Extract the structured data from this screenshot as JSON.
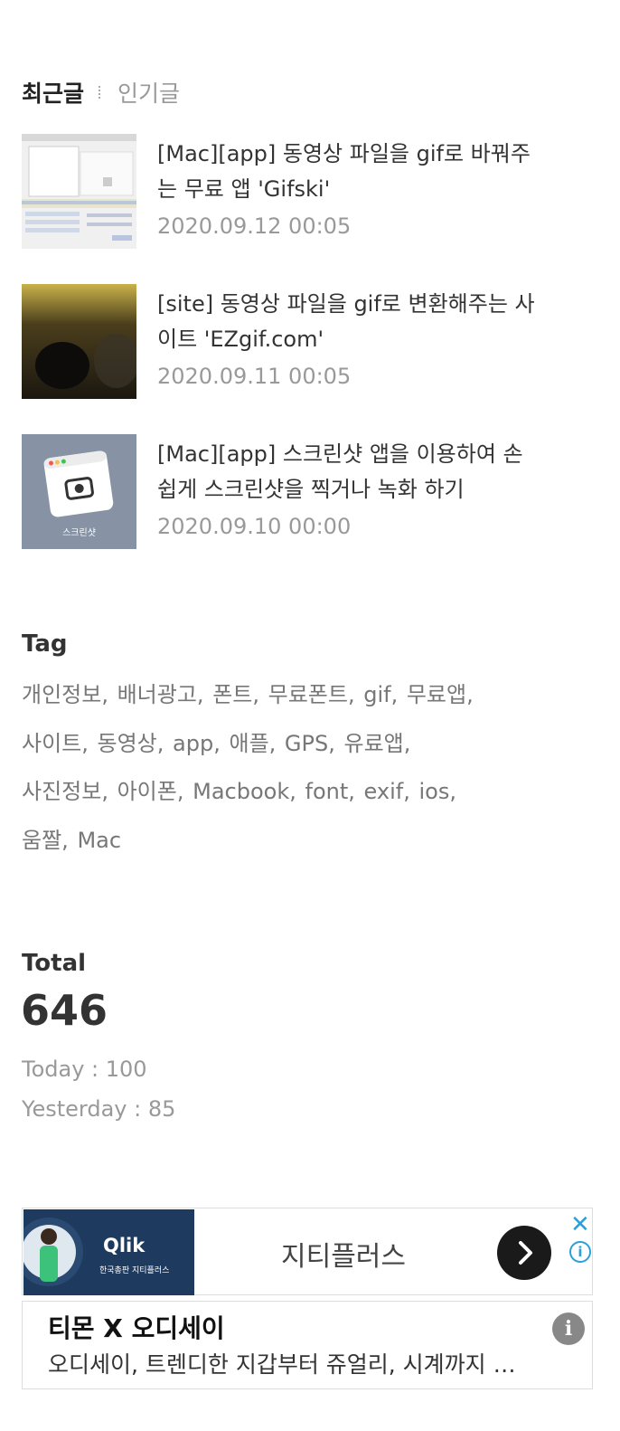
{
  "tabs": {
    "recent": "최근글",
    "popular": "인기글"
  },
  "posts": [
    {
      "title": "[Mac][app] 동영상 파일을 gif로 바꿔주는 무료 앱 'Gifski'",
      "date": "2020.09.12 00:05"
    },
    {
      "title": "[site] 동영상 파일을 gif로 변환해주는 사이트 'EZgif.com'",
      "date": "2020.09.11 00:05"
    },
    {
      "title": "[Mac][app] 스크린샷 앱을 이용하여 손쉽게 스크린샷을 찍거나 녹화 하기",
      "date": "2020.09.10 00:00",
      "thumb_label": "스크린샷"
    }
  ],
  "tag_section": {
    "title": "Tag",
    "tags": [
      "개인정보,",
      "배너광고,",
      "폰트,",
      "무료폰트,",
      "gif,",
      "무료앱,",
      "사이트,",
      "동영상,",
      "app,",
      "애플,",
      "GPS,",
      "유료앱,",
      "사진정보,",
      "아이폰,",
      "Macbook,",
      "font,",
      "exif,",
      "ios,",
      "움짤,",
      "Mac"
    ]
  },
  "counter": {
    "total_label": "Total",
    "total": "646",
    "today": "Today : 100",
    "yesterday": "Yesterday : 85"
  },
  "ad1": {
    "brand": "Qlik",
    "brand_sub": "한국총판 지티플러스",
    "name": "지티플러스"
  },
  "ad2": {
    "title": "티몬 X 오디세이",
    "desc": "오디세이, 트렌디한 지갑부터 쥬얼리, 시계까지 할인 판매 중"
  },
  "colors": {
    "accent": "#2b9fd8",
    "ad_banner": "#1e3a5f"
  }
}
